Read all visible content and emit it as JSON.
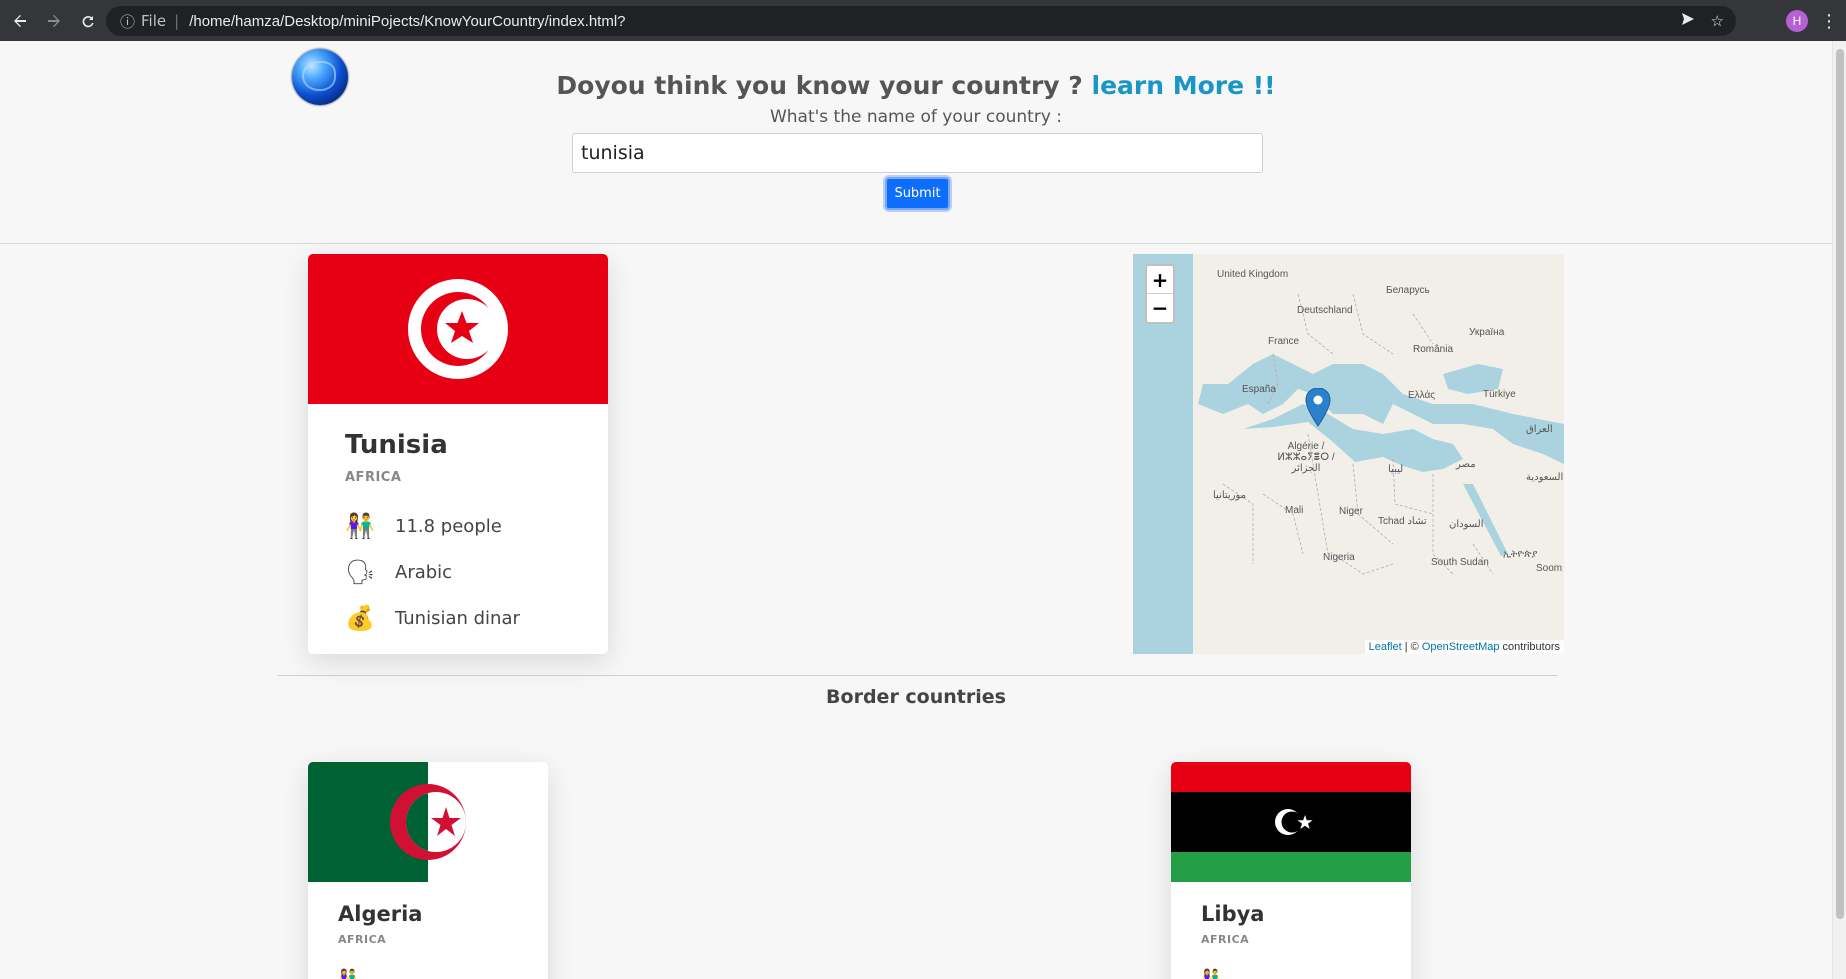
{
  "browser": {
    "file_label": "File",
    "url": "/home/hamza/Desktop/miniPojects/KnowYourCountry/index.html?",
    "profile_initial": "H"
  },
  "header": {
    "headline_prefix": "Doyou think you know your country ?",
    "headline_link": "learn More !!",
    "question": "What's the name of your country :",
    "input_value": "tunisia",
    "submit_label": "Submit"
  },
  "country": {
    "name": "Tunisia",
    "region": "AFRICA",
    "population": "11.8 people",
    "language": "Arabic",
    "currency": "Tunisian dinar",
    "icons": {
      "population": "people-icon",
      "language": "speaking-head-icon",
      "currency": "money-bag-icon"
    }
  },
  "map": {
    "zoom_in": "+",
    "zoom_out": "−",
    "attr_leaflet": "Leaflet",
    "attr_sep": " | © ",
    "attr_osm": "OpenStreetMap",
    "attr_contrib": " contributors",
    "labels": [
      "United Kingdom",
      "Беларусь",
      "Deutschland",
      "Україна",
      "France",
      "România",
      "España",
      "Ελλάς",
      "Türkiye",
      "Algérie / ⵍⵣⵣⴰⵢⴻⵔ / الجزائر",
      "ليبيا",
      "مصر",
      "موريتانيا",
      "Mali",
      "Niger",
      "Tchad تشاد",
      "السودان",
      "Nigeria",
      "South Sudan",
      "العراق",
      "السعودية",
      "ኢትዮጵያ",
      "Soom"
    ]
  },
  "borders": {
    "title": "Border countries",
    "items": [
      {
        "name": "Algeria",
        "region": "AFRICA"
      },
      {
        "name": "Libya",
        "region": "AFRICA"
      }
    ]
  },
  "colors": {
    "accent_link": "#1a96c6",
    "submit_bg": "#0d6efd",
    "tunisia_red": "#e70013",
    "algeria_green": "#006233",
    "libya_red": "#e70013",
    "libya_green": "#239e46"
  }
}
